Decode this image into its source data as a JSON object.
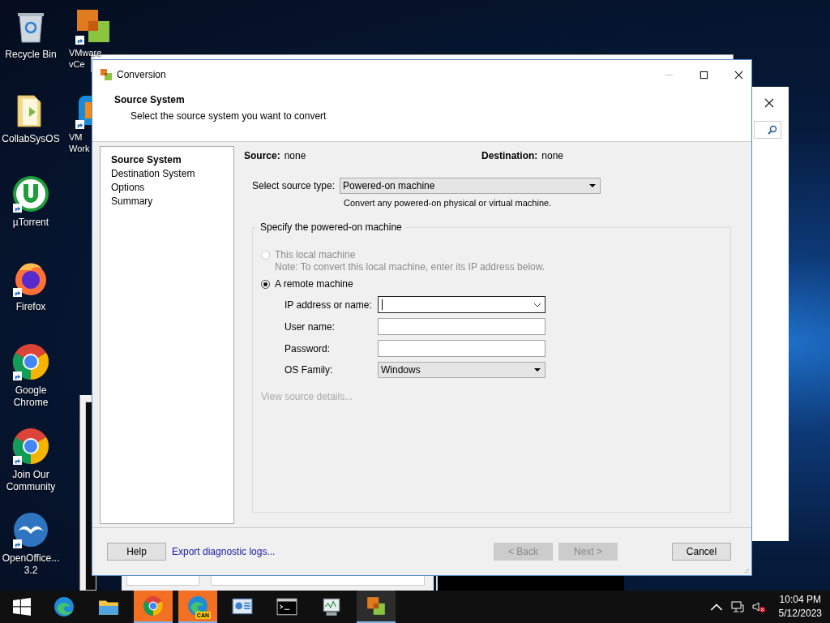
{
  "desktop_icons": [
    {
      "kind": "recycle-bin",
      "label": "Recycle Bin",
      "shortcut": false
    },
    {
      "kind": "folder",
      "label": "CollabSysOS",
      "shortcut": false
    },
    {
      "kind": "utorrent",
      "label": "µTorrent",
      "shortcut": true
    },
    {
      "kind": "firefox",
      "label": "Firefox",
      "shortcut": true
    },
    {
      "kind": "chrome",
      "label": "Google Chrome",
      "shortcut": true
    },
    {
      "kind": "chrome",
      "label": "Join Our Community",
      "shortcut": true
    },
    {
      "kind": "openoffice",
      "label": "OpenOffice... 3.2",
      "shortcut": true
    }
  ],
  "desktop_icons_2": [
    {
      "kind": "vmware",
      "label": "VMware vCe",
      "shortcut": true
    },
    {
      "kind": "workstation",
      "label": "VM Work",
      "shortcut": true
    }
  ],
  "dialog": {
    "title": "Conversion",
    "header": {
      "title": "Source System",
      "subtitle": "Select the source system you want to convert"
    },
    "steps": [
      {
        "label": "Source System",
        "selected": true
      },
      {
        "label": "Destination System",
        "selected": false
      },
      {
        "label": "Options",
        "selected": false
      },
      {
        "label": "Summary",
        "selected": false
      }
    ],
    "summary": [
      {
        "label": "Source:",
        "value": "none"
      },
      {
        "label": "Destination:",
        "value": "none"
      }
    ],
    "source_type": {
      "label": "Select source type:",
      "value": "Powered-on machine",
      "description": "Convert any powered-on physical or virtual machine."
    },
    "group": {
      "title": "Specify the powered-on machine",
      "options": [
        {
          "label": "This local machine",
          "note": "Note: To convert this local machine, enter its IP address below.",
          "selected": false,
          "disabled": true
        },
        {
          "label": "A remote machine",
          "selected": true,
          "disabled": false
        }
      ],
      "fields": [
        {
          "label": "IP address or name:",
          "kind": "combo",
          "focused": true
        },
        {
          "label": "User name:",
          "kind": "text",
          "focused": false
        },
        {
          "label": "Password:",
          "kind": "password",
          "focused": false
        },
        {
          "label": "OS Family:",
          "kind": "dropdown",
          "value": "Windows",
          "focused": false
        }
      ],
      "details_link": {
        "label": "View source details...",
        "disabled": true
      }
    },
    "buttons": [
      {
        "kind": "button",
        "label": "Help",
        "disabled": false
      },
      {
        "kind": "link",
        "label": "Export diagnostic logs...",
        "disabled": false
      },
      {
        "kind": "spacer"
      },
      {
        "kind": "button",
        "label": "< Back",
        "disabled": true
      },
      {
        "kind": "button",
        "label": "Next >",
        "disabled": true
      },
      {
        "kind": "gap"
      },
      {
        "kind": "button",
        "label": "Cancel",
        "disabled": false
      }
    ]
  },
  "taskbar": {
    "apps": [
      {
        "kind": "edge",
        "active": false
      },
      {
        "kind": "explorer",
        "active": false
      },
      {
        "kind": "chrome",
        "active": true
      },
      {
        "kind": "edge-can",
        "active": true,
        "badge": "CAN"
      },
      {
        "kind": "control-panel",
        "active": false
      },
      {
        "kind": "cmd",
        "active": false
      },
      {
        "kind": "perfmon",
        "active": false
      },
      {
        "kind": "vmware",
        "active": true
      }
    ],
    "time": "10:04 PM",
    "date": "5/12/2023"
  }
}
